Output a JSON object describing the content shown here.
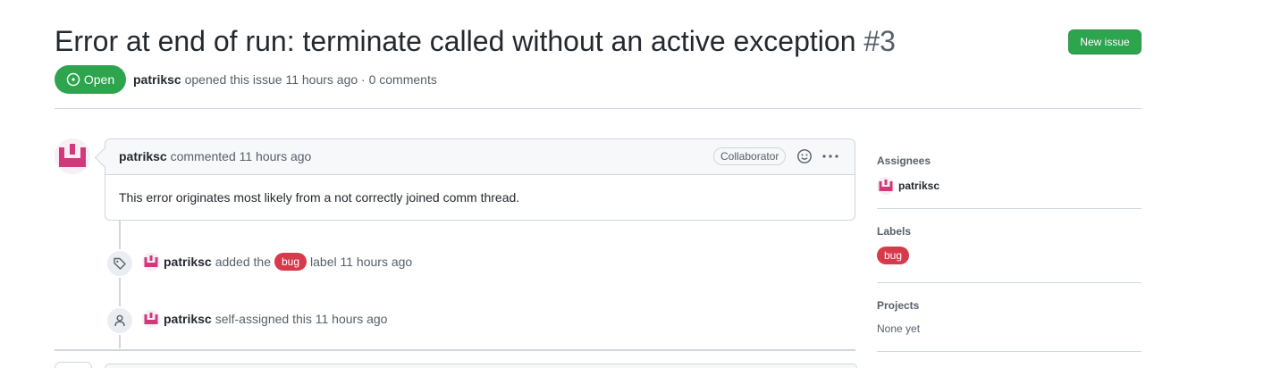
{
  "issue": {
    "title": "Error at end of run: terminate called without an active exception",
    "number": "#3",
    "state_label": "Open",
    "author": "patriksc",
    "opened_text": "opened this issue 11 hours ago · 0 comments"
  },
  "header": {
    "new_issue_label": "New issue"
  },
  "comment": {
    "author": "patriksc",
    "action": "commented 11 hours ago",
    "role_badge": "Collaborator",
    "body": "This error originates most likely from a not correctly joined comm thread."
  },
  "events": [
    {
      "icon": "tag-icon",
      "actor": "patriksc",
      "before": "added the",
      "label": "bug",
      "after": "label 11 hours ago"
    },
    {
      "icon": "person-icon",
      "actor": "patriksc",
      "text": "self-assigned this 11 hours ago"
    }
  ],
  "sidebar": {
    "assignees_title": "Assignees",
    "assignee": "patriksc",
    "labels_title": "Labels",
    "label": "bug",
    "projects_title": "Projects",
    "projects_value": "None yet"
  },
  "colors": {
    "green": "#2da44e",
    "bug": "#d73a4a",
    "avatar_pink": "#d2387a"
  }
}
